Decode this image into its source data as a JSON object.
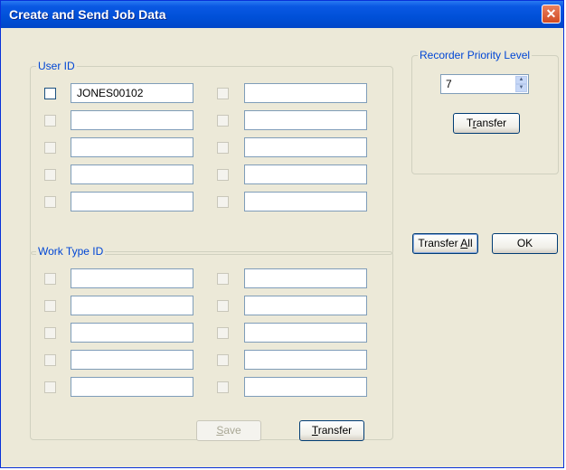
{
  "window": {
    "title": "Create and Send Job Data",
    "close_glyph": "✕"
  },
  "user_id": {
    "legend": "User ID",
    "left_values": [
      "JONES00102",
      "",
      "",
      "",
      ""
    ],
    "right_values": [
      "",
      "",
      "",
      "",
      ""
    ]
  },
  "work_type_id": {
    "legend": "Work Type ID",
    "left_values": [
      "",
      "",
      "",
      "",
      ""
    ],
    "right_values": [
      "",
      "",
      "",
      "",
      ""
    ]
  },
  "priority": {
    "legend": "Recorder Priority Level",
    "value": "7",
    "transfer": {
      "pre": "T",
      "mnemonic": "r",
      "post": "ansfer"
    }
  },
  "buttons": {
    "save": {
      "pre": "",
      "mnemonic": "S",
      "post": "ave",
      "enabled": false
    },
    "transfer": {
      "pre": "",
      "mnemonic": "T",
      "post": "ransfer"
    },
    "transfer_all": {
      "pre": "Transfer ",
      "mnemonic": "A",
      "post": "ll"
    },
    "ok": "OK"
  },
  "icons": {
    "close": "close-icon",
    "spin_up": "spin-up-icon",
    "spin_down": "spin-down-icon"
  },
  "colors": {
    "title_bar": "#0050d8",
    "group_legend": "#0046d5",
    "dialog_bg": "#ece9d8"
  }
}
